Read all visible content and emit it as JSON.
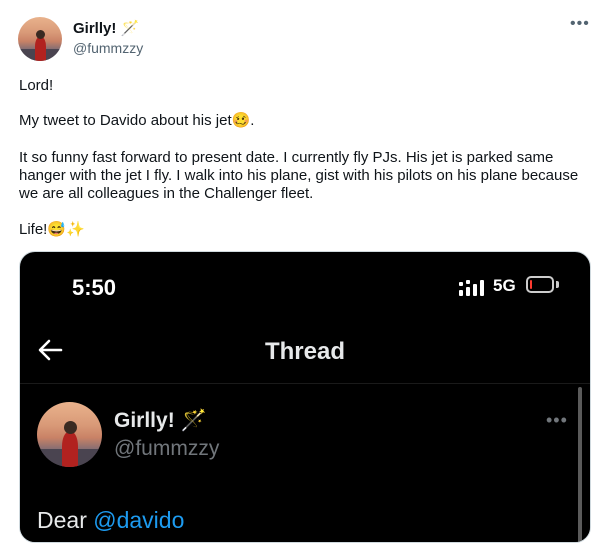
{
  "tweet": {
    "display_name": "Girlly!",
    "name_emoji": "🪄",
    "handle": "@fummzzy",
    "more_icon": "more-horizontal-icon",
    "paragraphs": {
      "p1": "Lord!",
      "p2": "My tweet to Davido about his jet🥴.",
      "p3": "It so funny fast forward to present date. I currently fly PJs. His jet is parked same hanger with the jet I fly. I walk into his plane, gist with his pilots on his plane because we are all colleagues in the Challenger fleet.",
      "p4": "Life!😅✨"
    }
  },
  "media": {
    "status_time": "5:50",
    "network": "5G",
    "battery_level": 0.1,
    "header_title": "Thread",
    "back_icon": "arrow-left-icon",
    "inner_display_name": "Girlly! 🪄",
    "inner_handle": "@fummzzy",
    "inner_text_prefix": "Dear ",
    "inner_mention": "@davido"
  },
  "colors": {
    "mention": "#1d9bf0",
    "secondary_text": "#536471",
    "media_bg": "#000000"
  }
}
